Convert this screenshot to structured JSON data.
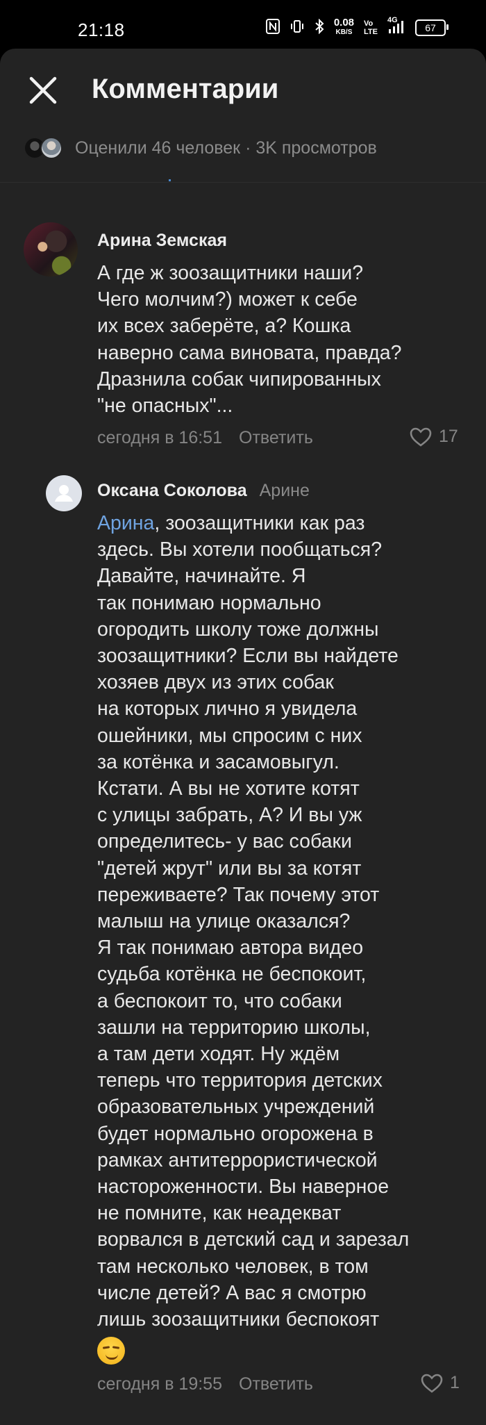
{
  "status_bar": {
    "time": "21:18",
    "net_speed": "0.08",
    "net_speed_unit": "KB/S",
    "vo_top": "Vo",
    "vo_bottom": "LTE",
    "signal": "4G",
    "battery": "67"
  },
  "header": {
    "title": "Комментарии",
    "liked_text": "Оценили 46 человек · 3K просмотров"
  },
  "comments": [
    {
      "author": "Арина Земская",
      "lines": [
        "А где ж зоозащитники наши?",
        "Чего молчим?) может к себе",
        "их всех заберёте, а? Кошка",
        "наверно сама виновата, правда?",
        "Дразнила собак чипированных",
        "\"не опасных\"..."
      ],
      "time": "сегодня в 16:51",
      "reply_label": "Ответить",
      "likes": "17"
    },
    {
      "author": "Оксана Соколова",
      "reply_to": "Арине",
      "mention": "Арина",
      "first_line_rest": ", зоозащитники как раз",
      "lines": [
        "здесь. Вы хотели пообщаться?",
        "Давайте, начинайте. Я",
        "так понимаю нормально",
        "огородить школу тоже должны",
        "зоозащитники? Если вы найдете",
        "хозяев двух из этих собак",
        "на которых лично я увидела",
        "ошейники, мы спросим с них",
        "за котёнка и засамовыгул.",
        "Кстати. А вы не хотите котят",
        "с улицы забрать, А? И вы уж",
        "определитесь- у вас собаки",
        "\"детей жрут\" или вы за котят",
        "переживаете? Так почему этот",
        "малыш на улице оказался?",
        "Я так понимаю автора видео",
        "судьба котёнка не беспокоит,",
        "а беспокоит то, что собаки",
        "зашли на территорию школы,",
        "а там дети ходят. Ну ждём",
        "теперь что территория детских",
        "образовательных учреждений",
        "будет нормально огорожена в",
        "рамках антитеррористической",
        "настороженности. Вы наверное",
        "не помните, как неадекват",
        "ворвался в детский сад и зарезал",
        "там несколько человек, в том",
        "числе детей? А вас я смотрю",
        "лишь зоозащитники беспокоят"
      ],
      "emoji": "smirk",
      "time": "сегодня в 19:55",
      "reply_label": "Ответить",
      "likes": "1"
    }
  ]
}
